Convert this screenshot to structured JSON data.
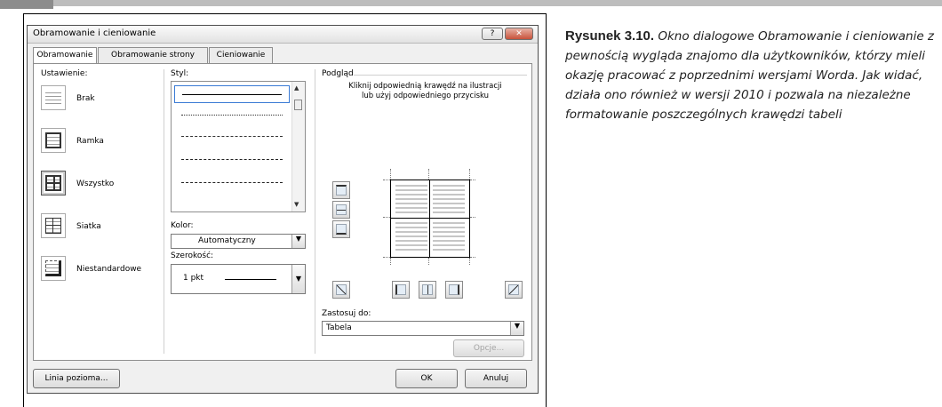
{
  "dialog": {
    "title": "Obramowanie i cieniowanie",
    "help_label": "?",
    "close_label": "✕",
    "tabs": [
      {
        "label": "Obramowanie",
        "active": true
      },
      {
        "label": "Obramowanie strony",
        "active": false
      },
      {
        "label": "Cieniowanie",
        "active": false
      }
    ],
    "setting_label": "Ustawienie:",
    "presets": [
      {
        "label": "Brak",
        "icon": "no-border-icon"
      },
      {
        "label": "Ramka",
        "icon": "box-border-icon"
      },
      {
        "label": "Wszystko",
        "icon": "all-borders-icon",
        "selected": true
      },
      {
        "label": "Siatka",
        "icon": "grid-border-icon"
      },
      {
        "label": "Niestandardowe",
        "icon": "custom-border-icon"
      }
    ],
    "style_label": "Styl:",
    "color_label": "Kolor:",
    "color_value": "Automatyczny",
    "width_label": "Szerokość:",
    "width_value": "1 pkt",
    "preview_label": "Podgląd",
    "preview_hint": "Kliknij odpowiednią krawędź na ilustracji lub użyj odpowiedniego przycisku",
    "apply_label": "Zastosuj do:",
    "apply_value": "Tabela",
    "options_label": "Opcje...",
    "hline_label": "Linia pozioma...",
    "ok_label": "OK",
    "cancel_label": "Anuluj"
  },
  "caption": {
    "figure": "Rysunek 3.10.",
    "text": "Okno dialogowe Obramowanie i cieniowanie z pewnością wygląda znajomo dla użytkowników, którzy mieli okazję pracować z poprzednimi wersjami Worda. Jak widać, działa ono również w wersji 2010 i pozwala na niezależne formatowanie poszczególnych krawędzi tabeli"
  }
}
